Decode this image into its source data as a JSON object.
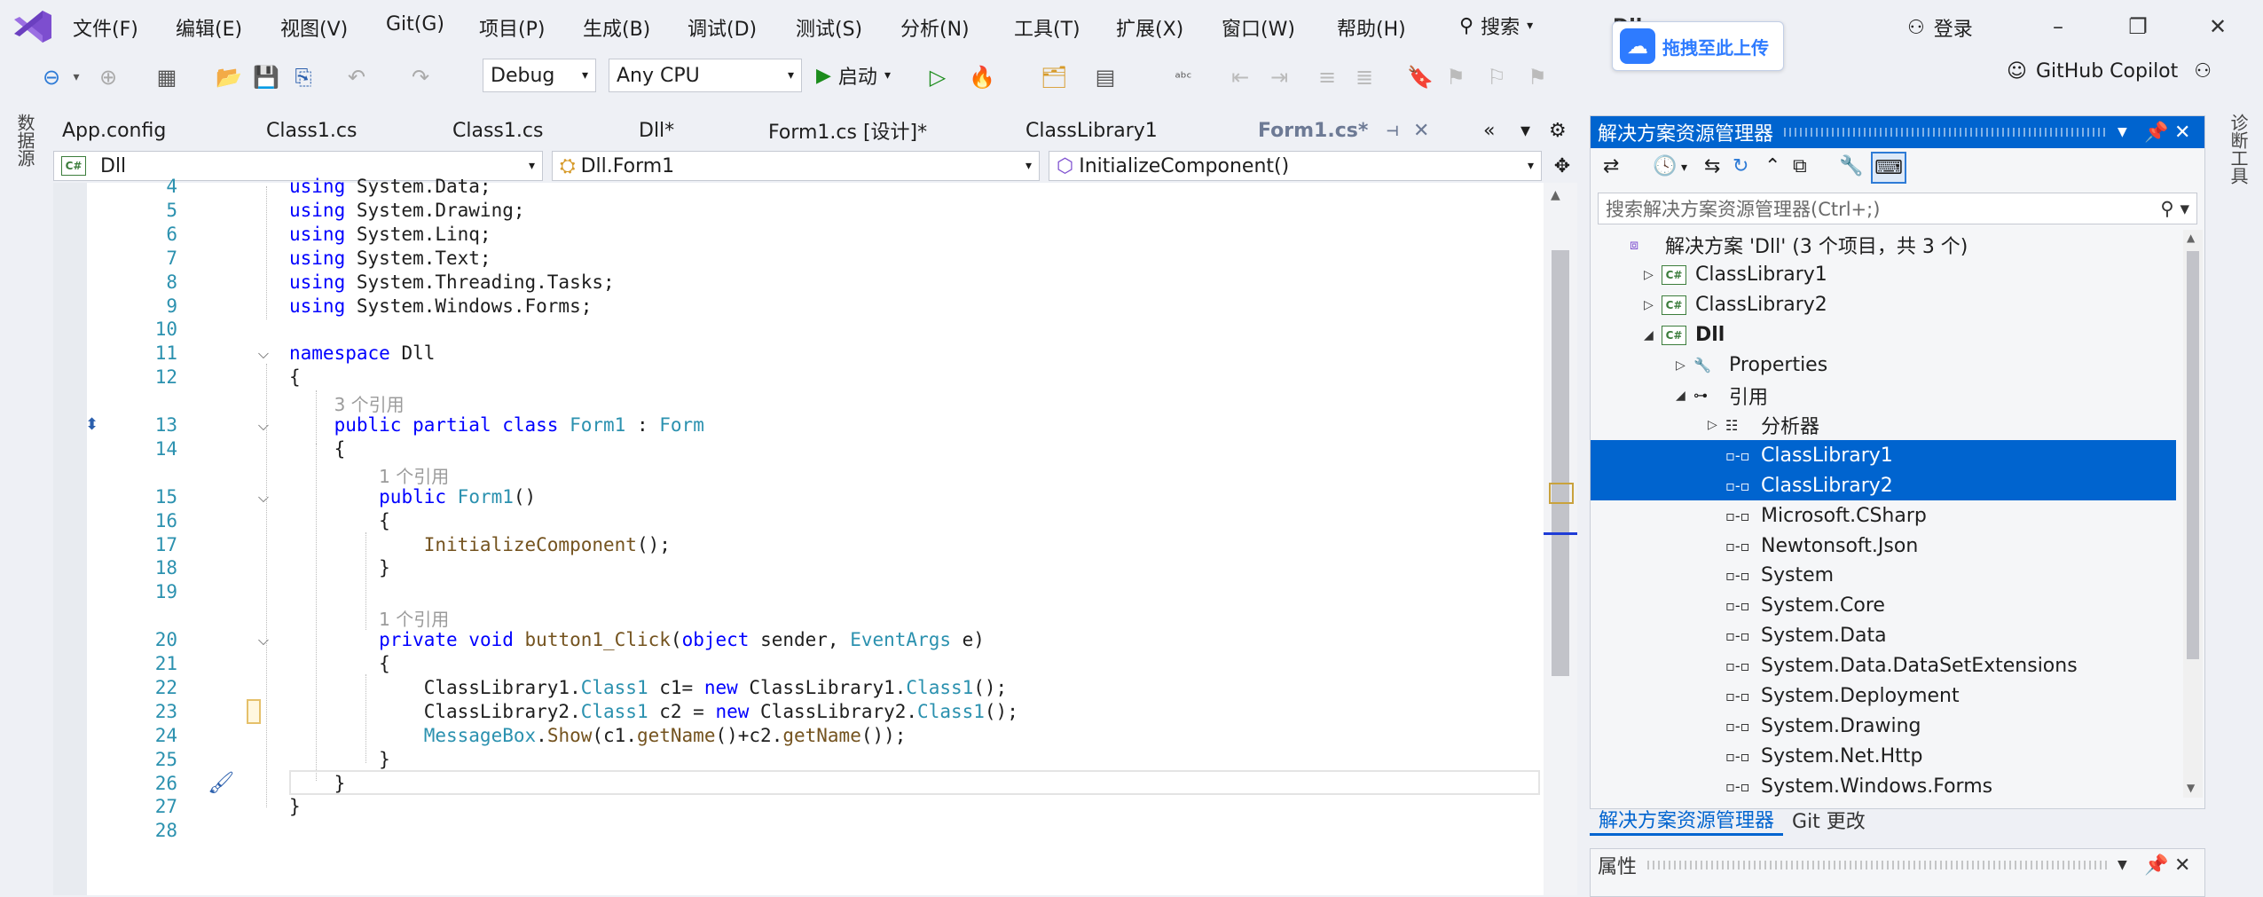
{
  "menu": {
    "items": [
      "文件(F)",
      "编辑(E)",
      "视图(V)",
      "Git(G)",
      "项目(P)",
      "生成(B)",
      "调试(D)",
      "测试(S)",
      "分析(N)",
      "工具(T)",
      "扩展(X)",
      "窗口(W)",
      "帮助(H)"
    ],
    "search_label": "搜索",
    "login_label": "登录"
  },
  "baidu_popup": {
    "label": "拖拽至此上传",
    "overlay_text": "Dll"
  },
  "toolbar": {
    "config": "Debug",
    "platform": "Any CPU",
    "start_label": "启动",
    "copilot_label": "GitHub Copilot"
  },
  "side_strips": {
    "left": "数据源",
    "right": "诊断工具"
  },
  "tabs": [
    {
      "label": "App.config",
      "active": false
    },
    {
      "label": "Class1.cs",
      "active": false
    },
    {
      "label": "Class1.cs",
      "active": false
    },
    {
      "label": "Dll*",
      "active": false
    },
    {
      "label": "Form1.cs [设计]*",
      "active": false
    },
    {
      "label": "ClassLibrary1",
      "active": false
    },
    {
      "label": "Form1.cs*",
      "active": true
    }
  ],
  "navbar": {
    "project": "Dll",
    "class": "Dll.Form1",
    "member": "InitializeComponent()"
  },
  "code": {
    "lines": [
      {
        "n": "4",
        "html": "<span class='kw'>using</span> System.Data;"
      },
      {
        "n": "5",
        "html": "<span class='kw'>using</span> System.Drawing;"
      },
      {
        "n": "6",
        "html": "<span class='kw'>using</span> System.Linq;"
      },
      {
        "n": "7",
        "html": "<span class='kw'>using</span> System.Text;"
      },
      {
        "n": "8",
        "html": "<span class='kw'>using</span> System.Threading.Tasks;"
      },
      {
        "n": "9",
        "html": "<span class='kw'>using</span> System.Windows.Forms;"
      },
      {
        "n": "10",
        "html": ""
      },
      {
        "n": "11",
        "html": "<span class='kw'>namespace</span> Dll"
      },
      {
        "n": "12",
        "html": "{"
      },
      {
        "n": "",
        "html": "    <span class='ref'>3 个引用</span>"
      },
      {
        "n": "13",
        "html": "    <span class='kw'>public partial class</span> <span class='ty'>Form1</span> : <span class='ty'>Form</span>"
      },
      {
        "n": "14",
        "html": "    {"
      },
      {
        "n": "",
        "html": "        <span class='ref'>1 个引用</span>"
      },
      {
        "n": "15",
        "html": "        <span class='kw'>public</span> <span class='ty'>Form1</span>()"
      },
      {
        "n": "16",
        "html": "        {"
      },
      {
        "n": "17",
        "html": "            <span class='me'>InitializeComponent</span>();"
      },
      {
        "n": "18",
        "html": "        }"
      },
      {
        "n": "19",
        "html": ""
      },
      {
        "n": "",
        "html": "        <span class='ref'>1 个引用</span>"
      },
      {
        "n": "20",
        "html": "        <span class='kw'>private void</span> <span class='me'>button1_Click</span>(<span class='kw'>object</span> sender, <span class='ty'>EventArgs</span> e)"
      },
      {
        "n": "21",
        "html": "        {"
      },
      {
        "n": "22",
        "html": "            ClassLibrary1.<span class='ty'>Class1</span> c1= <span class='kw'>new</span> ClassLibrary1.<span class='ty'>Class1</span>();"
      },
      {
        "n": "23",
        "html": "            ClassLibrary2.<span class='ty'>Class1</span> c2 = <span class='kw'>new</span> ClassLibrary2.<span class='ty'>Class1</span>();"
      },
      {
        "n": "24",
        "html": "            <span class='ty'>MessageBox</span>.<span class='me'>Show</span>(c1.<span class='me'>getName</span>()+c2.<span class='me'>getName</span>());"
      },
      {
        "n": "25",
        "html": "        }"
      },
      {
        "n": "26",
        "html": "    }"
      },
      {
        "n": "27",
        "html": "}"
      },
      {
        "n": "28",
        "html": ""
      }
    ]
  },
  "solution_explorer": {
    "title": "解决方案资源管理器",
    "search_placeholder": "搜索解决方案资源管理器(Ctrl+;)",
    "tree": [
      {
        "label": "解决方案 'Dll' (3 个项目，共 3 个)",
        "indent": 0,
        "arrow": "",
        "icon": "solution-icon",
        "bold": false,
        "selected": false
      },
      {
        "label": "ClassLibrary1",
        "indent": 1,
        "arrow": "▷",
        "icon": "csharp-project-icon",
        "bold": false,
        "selected": false
      },
      {
        "label": "ClassLibrary2",
        "indent": 1,
        "arrow": "▷",
        "icon": "csharp-project-icon",
        "bold": false,
        "selected": false
      },
      {
        "label": "Dll",
        "indent": 1,
        "arrow": "◢",
        "icon": "csharp-project-icon",
        "bold": true,
        "selected": false
      },
      {
        "label": "Properties",
        "indent": 2,
        "arrow": "▷",
        "icon": "wrench-icon",
        "bold": false,
        "selected": false
      },
      {
        "label": "引用",
        "indent": 2,
        "arrow": "◢",
        "icon": "references-icon",
        "bold": false,
        "selected": false
      },
      {
        "label": "分析器",
        "indent": 3,
        "arrow": "▷",
        "icon": "analyzer-icon",
        "bold": false,
        "selected": false
      },
      {
        "label": "ClassLibrary1",
        "indent": 3,
        "arrow": "",
        "icon": "reference-icon",
        "bold": false,
        "selected": true
      },
      {
        "label": "ClassLibrary2",
        "indent": 3,
        "arrow": "",
        "icon": "reference-icon",
        "bold": false,
        "selected": true
      },
      {
        "label": "Microsoft.CSharp",
        "indent": 3,
        "arrow": "",
        "icon": "reference-icon",
        "bold": false,
        "selected": false
      },
      {
        "label": "Newtonsoft.Json",
        "indent": 3,
        "arrow": "",
        "icon": "reference-icon",
        "bold": false,
        "selected": false
      },
      {
        "label": "System",
        "indent": 3,
        "arrow": "",
        "icon": "reference-icon",
        "bold": false,
        "selected": false
      },
      {
        "label": "System.Core",
        "indent": 3,
        "arrow": "",
        "icon": "reference-icon",
        "bold": false,
        "selected": false
      },
      {
        "label": "System.Data",
        "indent": 3,
        "arrow": "",
        "icon": "reference-icon",
        "bold": false,
        "selected": false
      },
      {
        "label": "System.Data.DataSetExtensions",
        "indent": 3,
        "arrow": "",
        "icon": "reference-icon",
        "bold": false,
        "selected": false
      },
      {
        "label": "System.Deployment",
        "indent": 3,
        "arrow": "",
        "icon": "reference-icon",
        "bold": false,
        "selected": false
      },
      {
        "label": "System.Drawing",
        "indent": 3,
        "arrow": "",
        "icon": "reference-icon",
        "bold": false,
        "selected": false
      },
      {
        "label": "System.Net.Http",
        "indent": 3,
        "arrow": "",
        "icon": "reference-icon",
        "bold": false,
        "selected": false
      },
      {
        "label": "System.Windows.Forms",
        "indent": 3,
        "arrow": "",
        "icon": "reference-icon",
        "bold": false,
        "selected": false
      }
    ],
    "bottom_tabs": [
      "解决方案资源管理器",
      "Git 更改"
    ]
  },
  "properties_panel": {
    "title": "属性"
  },
  "colors": {
    "accent": "#0064cf",
    "keyword": "#0000ff",
    "type": "#2b91af",
    "method": "#74531f"
  }
}
